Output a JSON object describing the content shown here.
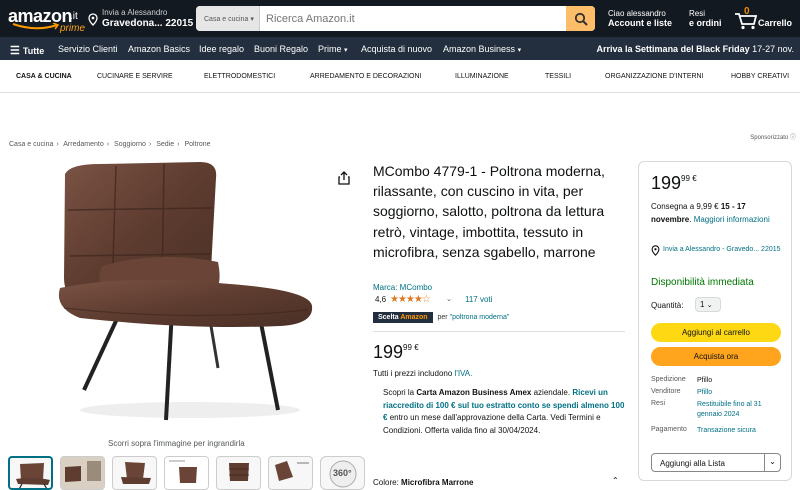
{
  "header": {
    "logo_text": "amazon",
    "logo_tld": ".it",
    "logo_sub": "prime",
    "deliver_line1": "Invia a Alessandro",
    "deliver_line2": "Gravedona... 22015",
    "search_category": "Casa e cucina",
    "search_placeholder": "Ricerca Amazon.it",
    "account_line1": "Ciao alessandro",
    "account_line2": "Account e liste",
    "orders_line1": "Resi",
    "orders_line2": "e ordini",
    "cart_count": "0",
    "cart_label": "Carrello"
  },
  "nav": {
    "all": "Tutte",
    "items": [
      "Servizio Clienti",
      "Amazon Basics",
      "Idee regalo",
      "Buoni Regalo",
      "Prime",
      "Acquista di nuovo",
      "Amazon Business"
    ],
    "promo": "Arriva la Settimana del Black Friday",
    "promo_dates": "17-27 nov."
  },
  "category_nav": [
    "CASA & CUCINA",
    "CUCINARE E SERVIRE",
    "ELETTRODOMESTICI",
    "ARREDAMENTO E DECORAZIONI",
    "ILLUMINAZIONE",
    "TESSILI",
    "ORGANIZZAZIONE D'INTERNI",
    "HOBBY CREATIVI"
  ],
  "sponsored": "Sponsorizzato",
  "breadcrumb": [
    "Casa e cucina",
    "Arredamento",
    "Soggiorno",
    "Sedie",
    "Poltrone"
  ],
  "gallery": {
    "zoom_hint": "Scorri sopra l'immagine per ingrandirla",
    "video_label": "360°"
  },
  "product": {
    "title": "MCombo 4779-1 - Poltrona moderna, rilassante, con cuscino in vita, per soggiorno, salotto, poltrona da lettura retrò, vintage, imbottita, tessuto in microfibra, senza sgabello, marrone",
    "brand": "Marca: MCombo",
    "rating": "4,6",
    "stars": "★★★★☆",
    "votes": "117 voti",
    "badge_prefix": "Scelta",
    "badge_brand": "Amazon",
    "badge_for": "per",
    "badge_keyword": "\"poltrona moderna\"",
    "price_whole": "199",
    "price_cents": "99",
    "price_currency": "€",
    "iva_prefix": "Tutti i prezzi includono",
    "iva_link": "l'IVA.",
    "amex_1": "Scopri la",
    "amex_2": "Carta Amazon Business Amex",
    "amex_3": "aziendale.",
    "amex_4": "Ricevi un riaccredito di 100 € sul tuo estratto conto se spendi almeno 100 €",
    "amex_5": "entro un mese dall'approvazione della Carta. Vedi Termini e Condizioni. Offerta valida fino al 30/04/2024.",
    "color_label": "Colore:",
    "color_value": "Microfibra Marrone"
  },
  "buybox": {
    "price_whole": "199",
    "price_cents": "99",
    "price_currency": "€",
    "delivery_prefix": "Consegna a 9,99 €",
    "delivery_dates": "15 - 17 novembre",
    "delivery_more": "Maggiori informazioni",
    "location": "Invia a Alessandro - Gravedo... 22015",
    "availability": "Disponibilità immediata",
    "qty_label": "Quantità:",
    "qty_value": "1",
    "add_to_cart": "Aggiungi al carrello",
    "buy_now": "Acquista ora",
    "info": [
      {
        "k": "Spedizione",
        "v": "Pfillo"
      },
      {
        "k": "Venditore",
        "v": "Pfillo"
      },
      {
        "k": "Resi",
        "v": "Restituibile fino al 31 gennaio 2024"
      },
      {
        "k": "Pagamento",
        "v": "Transazione sicura"
      }
    ],
    "add_to_list": "Aggiungi alla Lista"
  },
  "colors": {
    "header_bg": "#131921",
    "nav_bg": "#232f3e",
    "accent_orange": "#ff9900",
    "cart_button": "#ffd814",
    "buy_button": "#ffa41c",
    "link": "#007185",
    "in_stock": "#007600"
  }
}
